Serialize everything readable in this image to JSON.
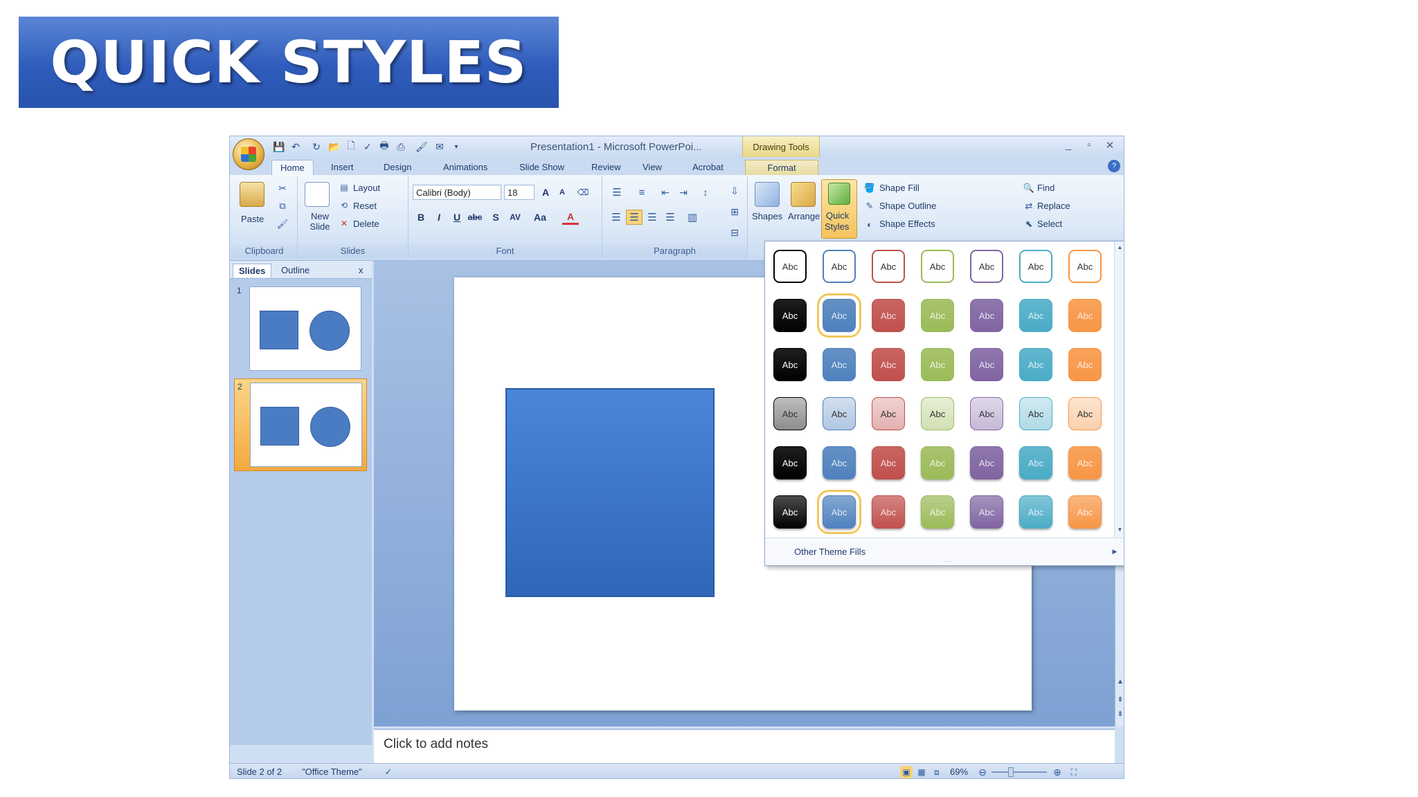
{
  "banner": {
    "title": "QUICK STYLES"
  },
  "window": {
    "title": "Presentation1 - Microsoft PowerPoi...",
    "contextual_tab_group": "Drawing Tools",
    "controls": {
      "minimize": "_",
      "restore": "▫",
      "close": "✕"
    }
  },
  "qat_icons": [
    "save-icon",
    "undo-icon",
    "redo-icon",
    "open-icon",
    "new-icon",
    "spelling-icon",
    "print-preview-icon",
    "quick-print-icon",
    "format-painter-icon",
    "email-icon"
  ],
  "tabs": [
    {
      "label": "Home",
      "active": true
    },
    {
      "label": "Insert"
    },
    {
      "label": "Design"
    },
    {
      "label": "Animations"
    },
    {
      "label": "Slide Show"
    },
    {
      "label": "Review"
    },
    {
      "label": "View"
    },
    {
      "label": "Acrobat"
    },
    {
      "label": "Format"
    }
  ],
  "ribbon": {
    "clipboard": {
      "label": "Clipboard",
      "paste": "Paste"
    },
    "slides": {
      "label": "Slides",
      "new_slide": "New Slide",
      "layout": "Layout",
      "reset": "Reset",
      "delete": "Delete"
    },
    "font": {
      "label": "Font",
      "font_name": "Calibri (Body)",
      "font_size": "18",
      "bold": "B",
      "italic": "I",
      "underline": "U",
      "strike": "abc",
      "shadow": "S",
      "spacing": "AV",
      "case": "Aa",
      "color": "A",
      "grow": "A",
      "shrink": "A"
    },
    "paragraph": {
      "label": "Paragraph"
    },
    "drawing": {
      "shapes": "Shapes",
      "arrange": "Arrange",
      "quick_styles_line1": "Quick",
      "quick_styles_line2": "Styles",
      "shape_fill": "Shape Fill",
      "shape_outline": "Shape Outline",
      "shape_effects": "Shape Effects"
    },
    "editing": {
      "find": "Find",
      "replace": "Replace",
      "select": "Select"
    }
  },
  "left_pane": {
    "tabs": [
      "Slides",
      "Outline"
    ],
    "close": "x",
    "thumbnails": [
      {
        "number": "1"
      },
      {
        "number": "2",
        "selected": true
      }
    ]
  },
  "gallery": {
    "swatch_text": "Abc",
    "colors": [
      "#000000",
      "#4f81bd",
      "#c0504d",
      "#9bbb59",
      "#8064a2",
      "#4bacc6",
      "#f79646"
    ],
    "rows": [
      {
        "style": "outline"
      },
      {
        "style": "moderate",
        "selected_col": 1
      },
      {
        "style": "subtle-dark"
      },
      {
        "style": "light"
      },
      {
        "style": "intense"
      },
      {
        "style": "intense-effect",
        "selected_col": 1
      }
    ],
    "footer": "Other Theme Fills"
  },
  "notes": {
    "placeholder": "Click to add notes"
  },
  "status_bar": {
    "slide": "Slide 2 of 2",
    "theme": "\"Office Theme\"",
    "zoom": "69%"
  }
}
